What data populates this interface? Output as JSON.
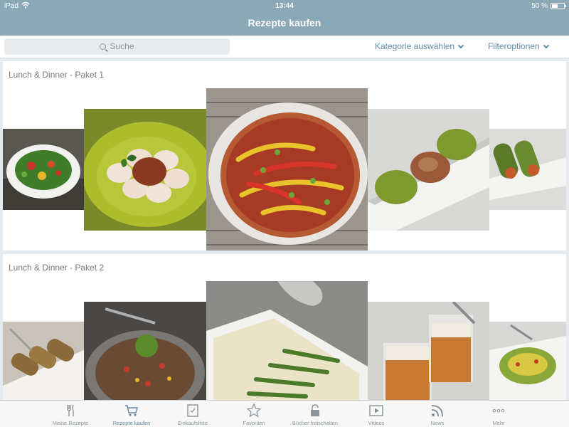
{
  "status": {
    "device": "iPad",
    "time": "13:44",
    "battery": "50 %"
  },
  "header": {
    "title": "Rezepte kaufen"
  },
  "filterbar": {
    "search_placeholder": "Suche",
    "category_label": "Kategorie auswählen",
    "filter_label": "Filteroptionen"
  },
  "packages": [
    {
      "title": "Lunch & Dinner - Paket 1",
      "images": [
        "salad-icon",
        "ravioli-icon",
        "pizza-icon",
        "pasta-nests-icon",
        "wraps-icon"
      ]
    },
    {
      "title": "Lunch & Dinner - Paket 2",
      "images": [
        "zucchini-rolls-icon",
        "lentil-salad-icon",
        "asparagus-soup-icon",
        "smoothie-glasses-icon",
        "vegetable-pasta-icon"
      ]
    }
  ],
  "tabs": [
    {
      "label": "Meine Rezepte",
      "icon": "utensils-icon"
    },
    {
      "label": "Rezepte kaufen",
      "icon": "cart-icon",
      "active": true
    },
    {
      "label": "Einkaufsliste",
      "icon": "checklist-icon"
    },
    {
      "label": "Favoriten",
      "icon": "star-icon"
    },
    {
      "label": "Bücher freischalten",
      "icon": "lock-icon"
    },
    {
      "label": "Videos",
      "icon": "play-icon"
    },
    {
      "label": "News",
      "icon": "rss-icon"
    },
    {
      "label": "Mehr",
      "icon": "more-icon"
    }
  ],
  "colors": {
    "header": "#8aa8b6",
    "accent": "#5f8ba3"
  }
}
